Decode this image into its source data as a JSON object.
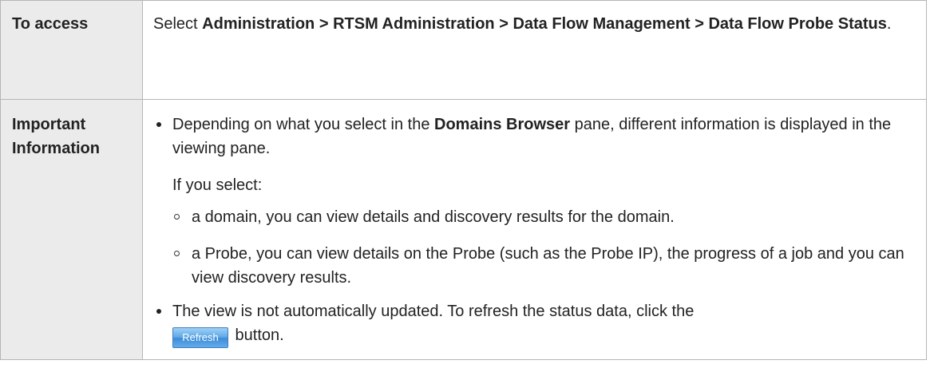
{
  "access": {
    "label": "To access",
    "prefix": "Select ",
    "path": "Administration > RTSM Administration > Data Flow Management > Data Flow Probe Status",
    "suffix": "."
  },
  "info": {
    "label": "Important Information",
    "bullet1": {
      "before": "Depending on what you select in the ",
      "bold": "Domains Browser",
      "after": " pane, different information is displayed in the viewing pane."
    },
    "if_select": "If you select:",
    "sub_items": [
      "a domain, you can view details and discovery results for the domain.",
      "a Probe, you can view details on the Probe (such as the Probe IP), the progress of a job and you can view discovery results."
    ],
    "bullet2": {
      "text": "The view is not automatically updated. To refresh the status data, click the ",
      "button_label": "Refresh",
      "after": " button."
    }
  },
  "colors": {
    "label_background": "#ebebeb",
    "border": "#b5b5b5",
    "button_blue": "#3d8cd9"
  }
}
